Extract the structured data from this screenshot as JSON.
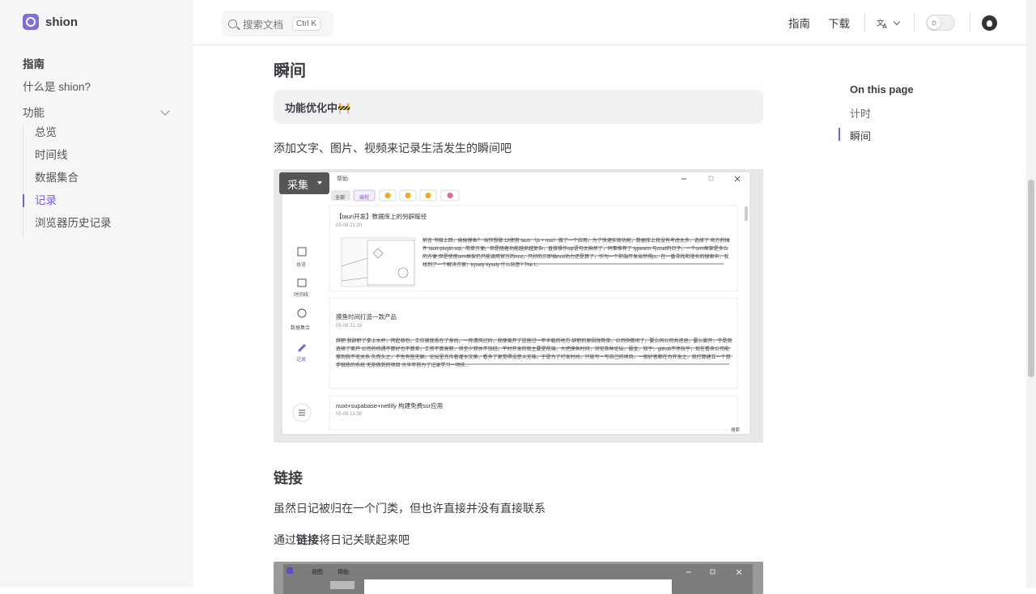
{
  "app": {
    "name": "shion"
  },
  "sidebar": {
    "heading": "指南",
    "items": [
      {
        "label": "什么是 shion?"
      },
      {
        "label": "功能"
      }
    ],
    "sub_items": [
      {
        "label": "总览"
      },
      {
        "label": "时间线"
      },
      {
        "label": "数据集合"
      },
      {
        "label": "记录"
      },
      {
        "label": "浏览器历史记录"
      }
    ]
  },
  "topbar": {
    "search_placeholder": "搜索文档",
    "search_shortcut": "Ctrl K",
    "nav_guide": "指南",
    "nav_download": "下载"
  },
  "main": {
    "section1_title": "瞬间",
    "tip": "功能优化中🚧",
    "section1_text": "添加文字、图片、视频来记录生活发生的瞬间吧",
    "section2_title": "链接",
    "section2_text1": "虽然日记被归在一个门类，但也许直接并没有直接联系",
    "section2_text2_pre": "通过",
    "section2_text2_bold": "链接",
    "section2_text2_post": "将日记关联起来吧"
  },
  "screenshot1": {
    "overlay_label": "采集",
    "menu_help": "帮助",
    "menu_view": "视图",
    "filters": [
      "全部",
      "编程"
    ],
    "nav_overview": "总览",
    "nav_timeline": "时间线",
    "nav_collection": "数据集合",
    "nav_record": "记录",
    "entry1_title": "【tauri开发】数据库上的另辟蹊径",
    "entry1_date": "05-08 21:20",
    "entry1_text": "前言 书接上回，偷偷摸鱼？ 当你想做 18使用 tauri （js + rust）做了一个应用。为了快速实现功能，数据库上我没有考虑太多，选择了 官方的插件 tauri-plugin-sql。简单方便。但是随着功能越来越复杂，直接操作sql语句太麻烦了，同事推荐了 typeorm 与crud的日子，一个orm框架是多么的方便 但是使用orm框架仍只能调用官方的rust，只好的三即插rust功力还是算了，作为一个前端开发当然得js。在一番寻找和漫长的搜索中，我找到了一个解决方案：kysely kysely 什么玩意? The t...",
    "entry2_title": "摸鱼时间打造一款产品",
    "entry2_date": "05-08 21:19",
    "entry2_text": "辞职 我辞职了拿上水杯，挎起背包，工位被我丢在了身后。一阵清风过后，我便离开了这座过一年半载的地方 辞职的原因很简单，公司快倒闭了，要么同公司共进退，要么离开，于是我选择了离开 公司的待遇不算好也不算差，工资不算高薪，但至少双休不加班。平时开发的就主要是前端，大把摸鱼时间，浏览各种论坛，掘金，知乎，github不停玩乎，现在看来公司能撑到我不无关系 久而久之，不免有些无聊。论坛里充斥着灌水文章，看多了更觉得没意义无味。于是为了打发时间，只能写一写自己的项目。一般好者都在为开发之，我打算建立一个双手锻炼的系统 无奈做到的项目 大半年前为了记录学习一项技...",
    "entry3_title": "nuxt+supabase+netlify 构建免费ssr应用",
    "entry3_date": "05-06 13:38",
    "search_label": "搜索"
  },
  "screenshot2": {
    "menu_view": "视图",
    "menu_help": "帮助"
  },
  "toc": {
    "title": "On this page",
    "items": [
      {
        "label": "计时"
      },
      {
        "label": "瞬间"
      }
    ]
  }
}
